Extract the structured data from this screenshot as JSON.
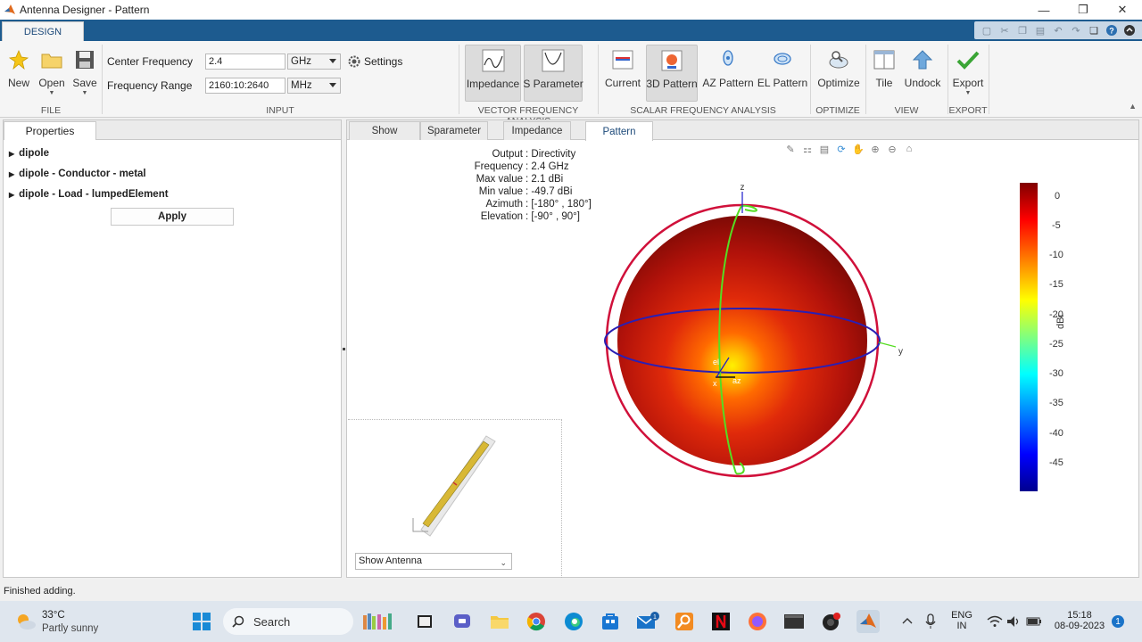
{
  "window": {
    "title": "Antenna Designer - Pattern"
  },
  "ribbon": {
    "tab_design": "DESIGN",
    "file": {
      "new_label": "New",
      "open_label": "Open",
      "save_label": "Save",
      "group_label": "FILE"
    },
    "input": {
      "center_frequency_label": "Center Frequency",
      "center_frequency_value": "2.4",
      "center_frequency_unit": "GHz",
      "frequency_range_label": "Frequency Range",
      "frequency_range_value": "2160:10:2640",
      "frequency_range_unit": "MHz",
      "settings_label": "Settings",
      "group_label": "INPUT"
    },
    "vector": {
      "impedance_label": "Impedance",
      "sparameter_label": "S Parameter",
      "group_label": "VECTOR FREQUENCY ANALYSIS"
    },
    "scalar": {
      "current_label": "Current",
      "pattern3d_label": "3D Pattern",
      "az_pattern_label": "AZ Pattern",
      "el_pattern_label": "EL Pattern",
      "group_label": "SCALAR FREQUENCY ANALYSIS"
    },
    "optimize": {
      "optimize_label": "Optimize",
      "group_label": "OPTIMIZE"
    },
    "view": {
      "tile_label": "Tile",
      "undock_label": "Undock",
      "group_label": "VIEW"
    },
    "export": {
      "export_label": "Export",
      "group_label": "EXPORT"
    }
  },
  "properties": {
    "tab_label": "Properties",
    "items": [
      {
        "label": "dipole"
      },
      {
        "label": "dipole - Conductor - metal"
      },
      {
        "label": "dipole - Load - lumpedElement"
      }
    ],
    "apply_label": "Apply"
  },
  "document": {
    "tabs": [
      {
        "label": "Show"
      },
      {
        "label": "Sparameter"
      },
      {
        "label": "Impedance"
      },
      {
        "label": "Pattern"
      }
    ],
    "active_tab": "Pattern",
    "info": [
      {
        "key": "Output",
        "value": "Directivity"
      },
      {
        "key": "Frequency",
        "value": "2.4 GHz"
      },
      {
        "key": "Max value",
        "value": "2.1 dBi"
      },
      {
        "key": "Min value",
        "value": "-49.7 dBi"
      },
      {
        "key": "Azimuth",
        "value": "[-180° , 180°]"
      },
      {
        "key": "Elevation",
        "value": "[-90° , 90°]"
      }
    ],
    "axis_labels": {
      "z": "z",
      "y": "y",
      "x": "x",
      "az": "az",
      "el": "el"
    },
    "colorbar": {
      "unit_label": "dBi",
      "ticks": [
        "0",
        "-5",
        "-10",
        "-15",
        "-20",
        "-25",
        "-30",
        "-35",
        "-40",
        "-45"
      ],
      "range": [
        -49.7,
        2.1
      ]
    },
    "show_antenna_label": "Show Antenna"
  },
  "status": {
    "text": "Finished adding."
  },
  "taskbar": {
    "weather_temp": "33°C",
    "weather_desc": "Partly sunny",
    "search_label": "Search",
    "lang_top": "ENG",
    "lang_bottom": "IN",
    "time": "15:18",
    "date": "08-09-2023",
    "notification_count": "1"
  },
  "colors": {
    "ribbon_blue": "#1d5b8f",
    "accent": "#1d4a7a",
    "sphere_red": "#a30c05",
    "circle_red": "#d0103a",
    "circle_blue": "#2a1fb4",
    "circle_green": "#55dd22"
  }
}
